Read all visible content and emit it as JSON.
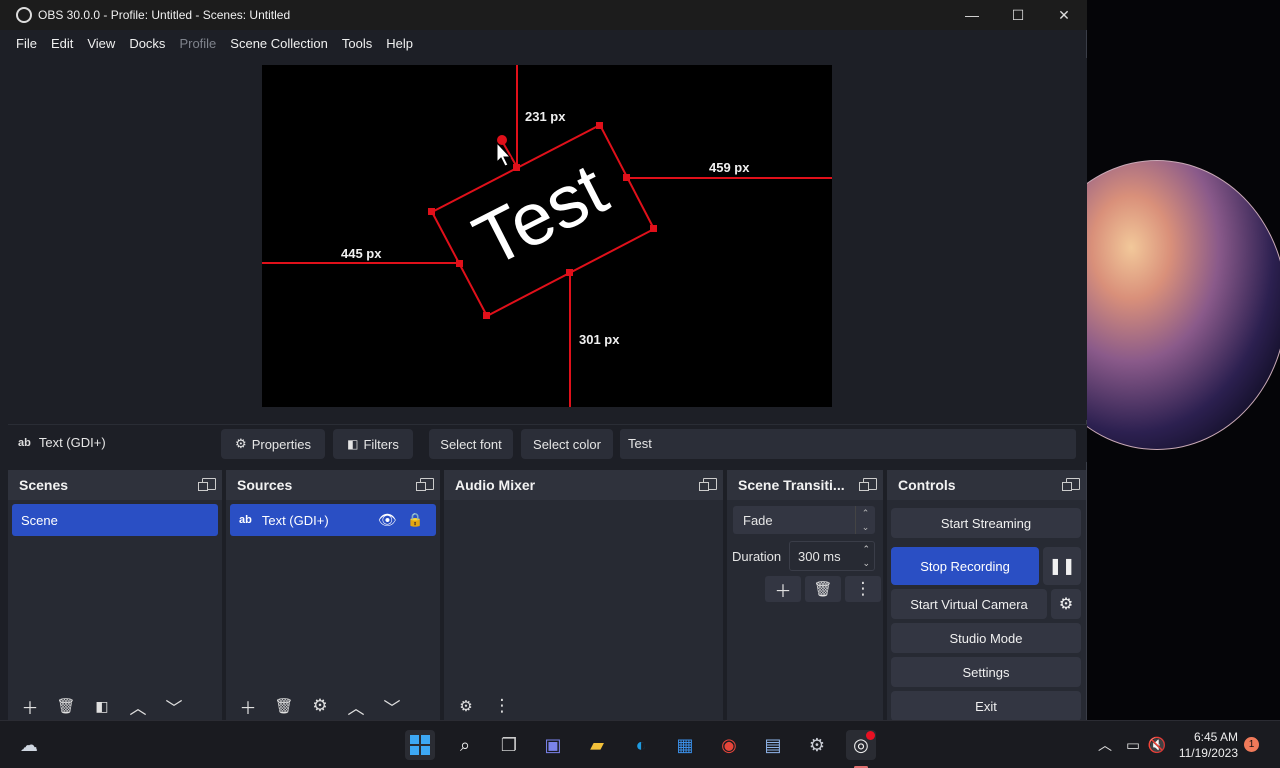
{
  "window": {
    "title": "OBS 30.0.0 - Profile: Untitled - Scenes: Untitled",
    "minimize": "—",
    "maximize": "☐",
    "close": "✕"
  },
  "menu": [
    "File",
    "Edit",
    "View",
    "Docks",
    "Profile",
    "Scene Collection",
    "Tools",
    "Help"
  ],
  "preview": {
    "source_text": "Test",
    "measure_top": "231 px",
    "measure_right": "459 px",
    "measure_left": "445 px",
    "measure_bottom": "301 px"
  },
  "contextbar": {
    "source_icon": "ab",
    "source_name": "Text (GDI+)",
    "properties_label": "Properties",
    "filters_label": "Filters",
    "select_font_label": "Select font",
    "select_color_label": "Select color",
    "text_value": "Test"
  },
  "scenes": {
    "title": "Scenes",
    "items": [
      "Scene"
    ]
  },
  "sources": {
    "title": "Sources",
    "items": [
      {
        "icon": "ab",
        "name": "Text (GDI+)"
      }
    ]
  },
  "audio_mixer": {
    "title": "Audio Mixer"
  },
  "transitions": {
    "title": "Scene Transiti...",
    "selected": "Fade",
    "duration_label": "Duration",
    "duration_value": "300 ms"
  },
  "controls": {
    "title": "Controls",
    "start_streaming": "Start Streaming",
    "stop_recording": "Stop Recording",
    "start_virtual_camera": "Start Virtual Camera",
    "studio_mode": "Studio Mode",
    "settings": "Settings",
    "exit": "Exit"
  },
  "taskbar": {
    "time": "6:45 AM",
    "date": "11/19/2023",
    "notification_count": "1"
  },
  "colors": {
    "accent": "#2a4fc4",
    "selection_red": "#e0101a",
    "dock_bg": "#272a33"
  }
}
